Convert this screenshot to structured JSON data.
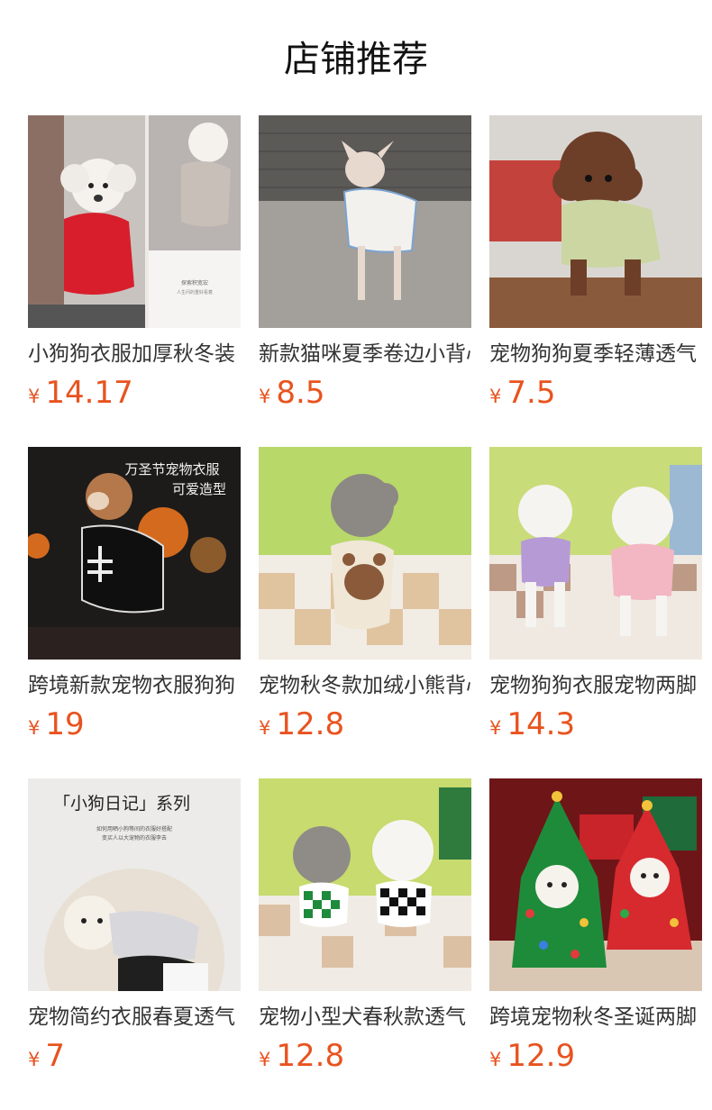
{
  "page": {
    "title": "店铺推荐"
  },
  "products": [
    {
      "title": "小狗狗衣服加厚秋冬装",
      "currency": "¥",
      "price": "14.17",
      "image": "white-poodle-red-fleece",
      "image_text": [
        "探索积宽宏",
        "人生问的重好看着"
      ]
    },
    {
      "title": "新款猫咪夏季卷边小背心",
      "currency": "¥",
      "price": "8.5",
      "image": "sphynx-cat-vest"
    },
    {
      "title": "宠物狗狗夏季轻薄透气",
      "currency": "¥",
      "price": "7.5",
      "image": "brown-poodle-green-shirt"
    },
    {
      "title": "跨境新款宠物衣服狗狗",
      "currency": "¥",
      "price": "19",
      "image": "halloween-skeleton-costume",
      "image_text": [
        "万圣节宠物衣服",
        "可爱造型"
      ]
    },
    {
      "title": "宠物秋冬款加绒小熊背心",
      "currency": "¥",
      "price": "12.8",
      "image": "grey-poodle-bear-vest"
    },
    {
      "title": "宠物狗狗衣服宠物两脚",
      "currency": "¥",
      "price": "14.3",
      "image": "two-bichons-sweaters"
    },
    {
      "title": "宠物简约衣服春夏透气",
      "currency": "¥",
      "price": "7",
      "image": "maltese-diary-series",
      "image_text": [
        "「小狗日记」系列",
        "如何用晒小狗等间的衣服好搭配",
        "变买人以大宠物的衣服李去"
      ]
    },
    {
      "title": "宠物小型犬春秋款透气",
      "currency": "¥",
      "price": "12.8",
      "image": "checkered-vests-pair"
    },
    {
      "title": "跨境宠物秋冬圣诞两脚",
      "currency": "¥",
      "price": "12.9",
      "image": "christmas-tree-capes"
    }
  ]
}
